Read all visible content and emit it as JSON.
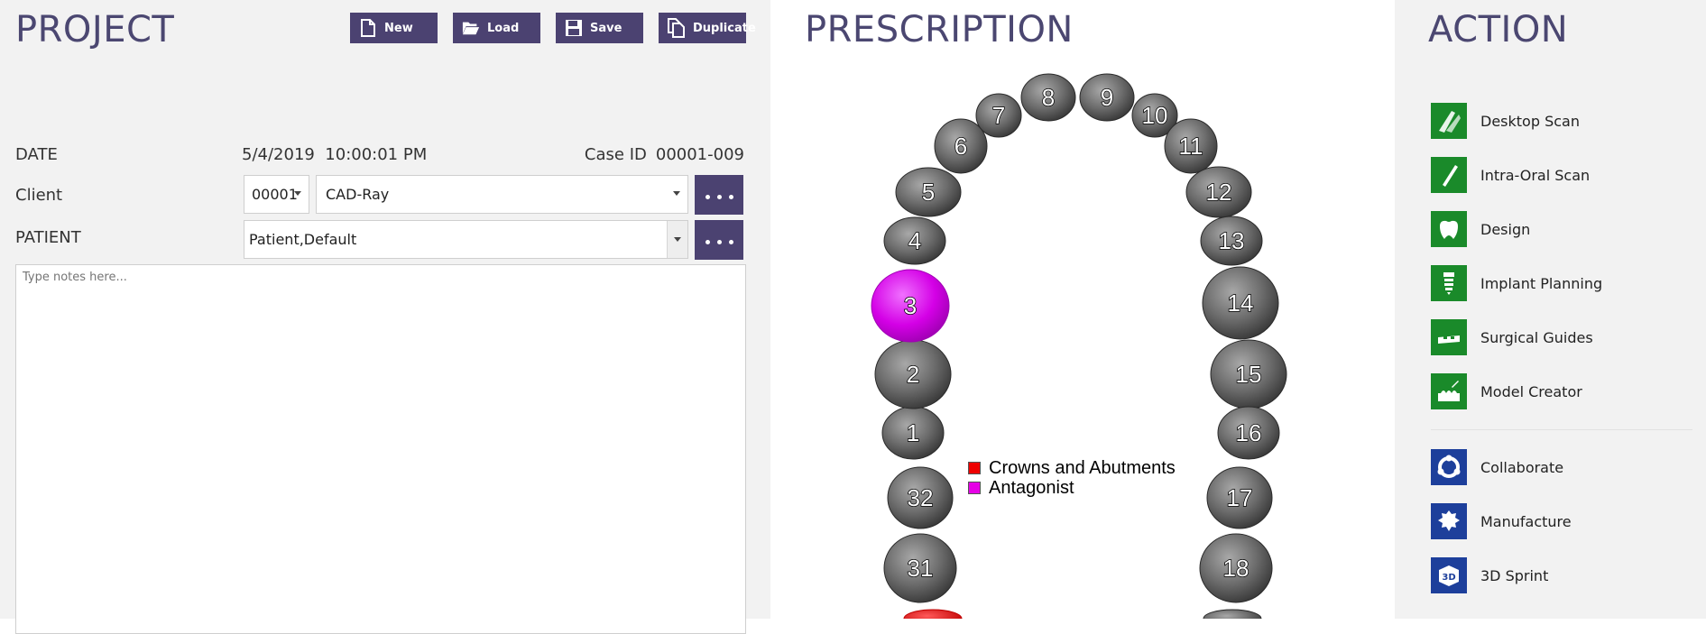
{
  "project": {
    "title": "PROJECT",
    "toolbar": {
      "new_label": "New",
      "load_label": "Load",
      "save_label": "Save",
      "duplicate_label": "Duplicate"
    },
    "date_label": "DATE",
    "date_value": "5/4/2019  10:00:01 PM",
    "case_id_label": "Case ID",
    "case_id_value": "00001-009",
    "client_label": "Client",
    "client_number": "00001",
    "client_name": "CAD-Ray",
    "patient_label": "PATIENT",
    "patient_name": "Patient,Default",
    "notes_placeholder": "Type notes here..."
  },
  "prescription": {
    "title": "PRESCRIPTION",
    "upper_teeth": [
      "1",
      "2",
      "3",
      "4",
      "5",
      "6",
      "7",
      "8",
      "9",
      "10",
      "11",
      "12",
      "13",
      "14",
      "15",
      "16"
    ],
    "lower_teeth": [
      "17",
      "18",
      "31",
      "32"
    ],
    "highlight": {
      "3": "#d400e6"
    },
    "legend": [
      {
        "label": "Crowns and Abutments",
        "color": "#ee0000"
      },
      {
        "label": "Antagonist",
        "color": "#e600e6"
      }
    ]
  },
  "action": {
    "title": "ACTION",
    "items": [
      {
        "label": "Desktop Scan",
        "icon": "desktop-scan-icon",
        "color": "#1a8a2a"
      },
      {
        "label": "Intra-Oral Scan",
        "icon": "intra-oral-scan-icon",
        "color": "#1a8a2a"
      },
      {
        "label": "Design",
        "icon": "design-icon",
        "color": "#1a8a2a"
      },
      {
        "label": "Implant Planning",
        "icon": "implant-planning-icon",
        "color": "#1a8a2a"
      },
      {
        "label": "Surgical Guides",
        "icon": "surgical-guides-icon",
        "color": "#1a8a2a"
      },
      {
        "label": "Model Creator",
        "icon": "model-creator-icon",
        "color": "#1a8a2a"
      },
      {
        "label": "Collaborate",
        "icon": "collaborate-icon",
        "color": "#1d3f9b"
      },
      {
        "label": "Manufacture",
        "icon": "manufacture-icon",
        "color": "#1d3f9b"
      },
      {
        "label": "3D Sprint",
        "icon": "3d-sprint-icon",
        "color": "#1d3f9b"
      }
    ]
  }
}
